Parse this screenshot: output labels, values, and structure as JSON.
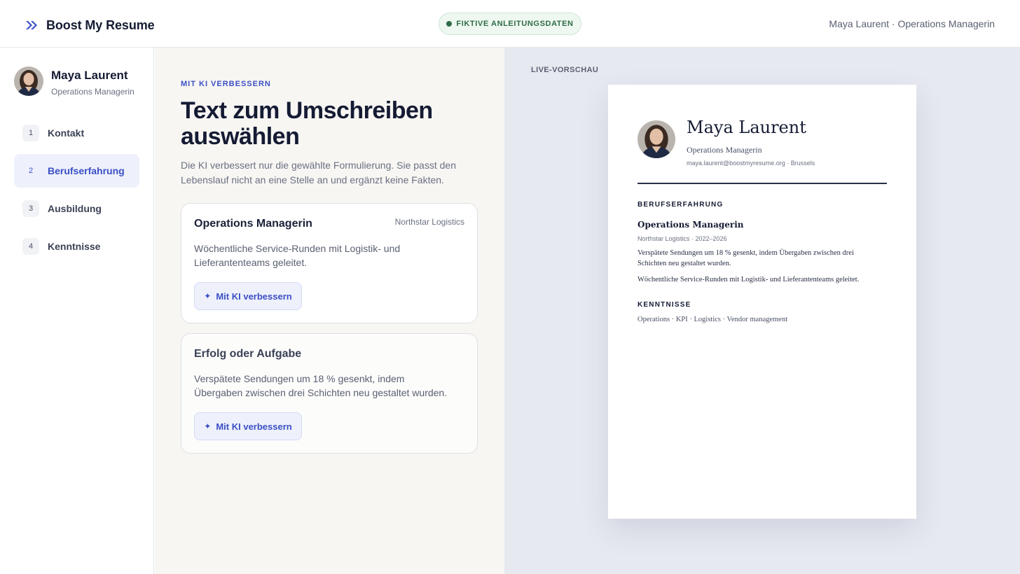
{
  "app": {
    "brand": "Boost My Resume",
    "demo_badge": "FIKTIVE ANLEITUNGSDATEN",
    "current_user": "Maya Laurent · Operations Managerin"
  },
  "sidebar": {
    "profile": {
      "name": "Maya Laurent",
      "role": "Operations Managerin"
    },
    "steps": [
      {
        "num": "1",
        "label": "Kontakt",
        "active": false
      },
      {
        "num": "2",
        "label": "Berufserfahrung",
        "active": true
      },
      {
        "num": "3",
        "label": "Ausbildung",
        "active": false
      },
      {
        "num": "4",
        "label": "Kenntnisse",
        "active": false
      }
    ]
  },
  "editor": {
    "eyebrow": "MIT KI VERBESSERN",
    "title": "Text zum Umschreiben auswählen",
    "description": "Die KI verbessert nur die gewählte Formulierung. Sie passt den Lebenslauf nicht an eine Stelle an und ergänzt keine Fakten.",
    "cards": [
      {
        "title": "Operations Managerin",
        "company": "Northstar Logistics",
        "text": "Wöchentliche Service-Runden mit Logistik- und Lieferantenteams geleitet.",
        "button": "Mit KI verbessern"
      },
      {
        "title": "Erfolg oder Aufgabe",
        "text": "Verspätete Sendungen um 18 % gesenkt, indem Übergaben zwischen drei Schichten neu gestaltet wurden.",
        "button": "Mit KI verbessern"
      }
    ]
  },
  "preview": {
    "label": "LIVE-VORSCHAU",
    "resume": {
      "name": "Maya Laurent",
      "role": "Operations Managerin",
      "contact": "maya.laurent@boostmyresume.org · Brussels",
      "experience_heading": "BERUFSERFAHRUNG",
      "job_title": "Operations Managerin",
      "job_meta": "Northstar Logistics · 2022–2026",
      "bullets": [
        "Verspätete Sendungen um 18 % gesenkt, indem Übergaben zwischen drei Schichten neu gestaltet wurden.",
        "Wöchentliche Service-Runden mit Logistik- und Lieferantenteams geleitet."
      ],
      "skills_heading": "KENNTNISSE",
      "skills": "Operations · KPI · Logistics · Vendor management"
    }
  },
  "colors": {
    "accent": "#3b4fc4",
    "accent_soft": "#eef1fc",
    "demo_green": "#2f6b46",
    "editor_bg": "#f7f6f3",
    "preview_bg": "#e7e9f1"
  },
  "icons": {
    "brand": "double-chevron-right-icon",
    "ai": "sparkle-icon"
  }
}
